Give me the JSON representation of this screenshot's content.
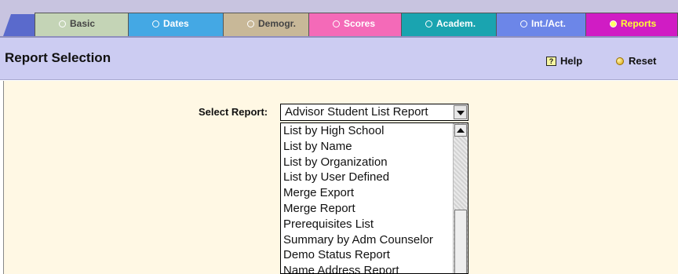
{
  "tabs": [
    {
      "label": "Basic"
    },
    {
      "label": "Dates"
    },
    {
      "label": "Demogr."
    },
    {
      "label": "Scores"
    },
    {
      "label": "Academ."
    },
    {
      "label": "Int./Act."
    },
    {
      "label": "Reports",
      "active": true
    }
  ],
  "header": {
    "title": "Report Selection",
    "help_label": "Help",
    "reset_label": "Reset",
    "help_glyph": "?"
  },
  "report": {
    "label": "Select Report:",
    "selected_value": "Advisor Student List Report",
    "options_visible": [
      "List by High School",
      "List by Name",
      "List by Organization",
      "List by User Defined",
      "Merge Export",
      "Merge Report",
      "Prerequisites List",
      "Summary by Adm Counselor",
      "Demo Status Report",
      "Name Address Report"
    ]
  },
  "colors": {
    "header_bg": "#ccccf2",
    "content_bg": "#fff8e4",
    "tab_bar_bg": "#c8c4e0",
    "active_tab_bg": "#d01cc4",
    "active_tab_text": "#ffff33"
  }
}
